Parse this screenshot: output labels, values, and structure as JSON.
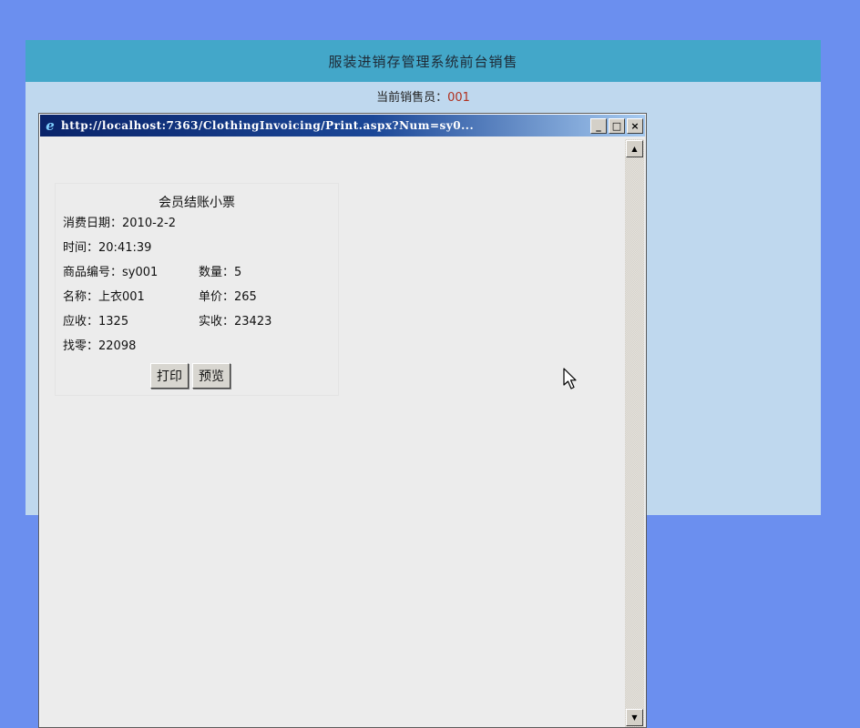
{
  "app": {
    "title": "服装进销存管理系统前台销售",
    "seller_label": "当前销售员：",
    "seller_id": "001"
  },
  "popup": {
    "title": "http://localhost:7363/ClothingInvoicing/Print.aspx?Num=sy0...",
    "buttons": {
      "minimize": "_",
      "maximize": "□",
      "close": "×"
    }
  },
  "receipt": {
    "title": "会员结账小票",
    "date_label": "消费日期：",
    "date": "2010-2-2",
    "time_label": "时间：",
    "time": "20:41:39",
    "product_code_label": "商品编号：",
    "product_code": "sy001",
    "quantity_label": "数量：",
    "quantity": "5",
    "name_label": "名称：",
    "name": "上衣001",
    "unit_price_label": "单价：",
    "unit_price": "265",
    "receivable_label": "应收：",
    "receivable": "1325",
    "received_label": "实收：",
    "received": "23423",
    "change_label": "找零：",
    "change": "22098",
    "print_button": "打印",
    "preview_button": "预览"
  },
  "icons": {
    "browser": "ie-icon",
    "scroll_up": "scroll-up-arrow-icon",
    "scroll_down": "scroll-down-arrow-icon",
    "cursor": "mouse-pointer-icon"
  },
  "colors": {
    "desktop": "#6b8fef",
    "header": "#43a7c9",
    "panel": "#bfd8ee",
    "titlebar": "#0a246a",
    "seller_id": "#b0301e"
  }
}
